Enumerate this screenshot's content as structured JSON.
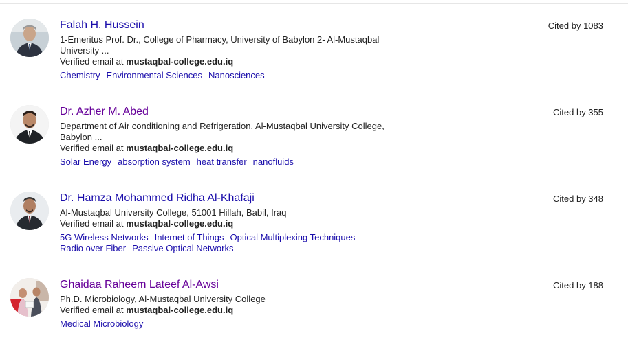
{
  "profiles": [
    {
      "name": "Falah H. Hussein",
      "affiliation": "1-Emeritus Prof. Dr., College of Pharmacy, University of Babylon 2- Al-Mustaqbal University ...",
      "email_prefix": "Verified email at ",
      "email_domain": "mustaqbal-college.edu.iq",
      "interests": [
        "Chemistry",
        "Environmental Sciences",
        "Nanosciences"
      ],
      "cited": "Cited by 1083"
    },
    {
      "name": "Dr. Azher M. Abed",
      "affiliation": "Department of Air conditioning and Refrigeration, Al-Mustaqbal University College, Babylon ...",
      "email_prefix": "Verified email at ",
      "email_domain": "mustaqbal-college.edu.iq",
      "interests": [
        "Solar Energy",
        "absorption system",
        "heat transfer",
        "nanofluids"
      ],
      "cited": "Cited by 355"
    },
    {
      "name": "Dr. Hamza Mohammed Ridha Al-Khafaji",
      "affiliation": "Al-Mustaqbal University College, 51001 Hillah, Babil, Iraq",
      "email_prefix": "Verified email at ",
      "email_domain": "mustaqbal-college.edu.iq",
      "interests": [
        "5G Wireless Networks",
        "Internet of Things",
        "Optical Multiplexing Techniques",
        "Radio over Fiber",
        "Passive Optical Networks"
      ],
      "cited": "Cited by 348"
    },
    {
      "name": "Ghaidaa Raheem Lateef Al-Awsi",
      "affiliation": "Ph.D. Microbiology, Al-Mustaqbal University College",
      "email_prefix": "Verified email at ",
      "email_domain": "mustaqbal-college.edu.iq",
      "interests": [
        "Medical Microbiology"
      ],
      "cited": "Cited by 188"
    }
  ],
  "colors": {
    "link": "#1a0dab",
    "visited": "#660099",
    "text": "#222222"
  }
}
